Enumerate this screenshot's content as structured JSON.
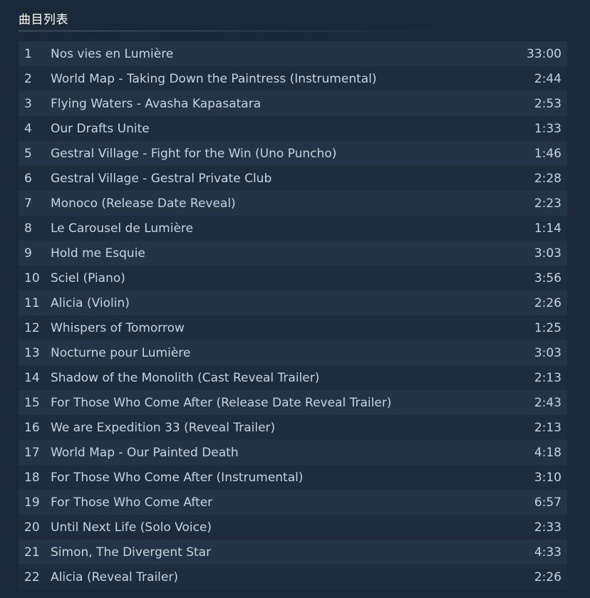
{
  "section": {
    "title": "曲目列表"
  },
  "tracks": [
    {
      "num": "1",
      "name": "Nos vies en Lumière",
      "duration": "33:00"
    },
    {
      "num": "2",
      "name": "World Map - Taking Down the Paintress (Instrumental)",
      "duration": "2:44"
    },
    {
      "num": "3",
      "name": "Flying Waters - Avasha Kapasatara",
      "duration": "2:53"
    },
    {
      "num": "4",
      "name": "Our Drafts Unite",
      "duration": "1:33"
    },
    {
      "num": "5",
      "name": "Gestral Village - Fight for the Win (Uno Puncho)",
      "duration": "1:46"
    },
    {
      "num": "6",
      "name": "Gestral Village - Gestral Private Club",
      "duration": "2:28"
    },
    {
      "num": "7",
      "name": "Monoco (Release Date Reveal)",
      "duration": "2:23"
    },
    {
      "num": "8",
      "name": "Le Carousel de Lumière",
      "duration": "1:14"
    },
    {
      "num": "9",
      "name": "Hold me Esquie",
      "duration": "3:03"
    },
    {
      "num": "10",
      "name": "Sciel (Piano)",
      "duration": "3:56"
    },
    {
      "num": "11",
      "name": "Alicia (Violin)",
      "duration": "2:26"
    },
    {
      "num": "12",
      "name": "Whispers of Tomorrow",
      "duration": "1:25"
    },
    {
      "num": "13",
      "name": "Nocturne pour Lumière",
      "duration": "3:03"
    },
    {
      "num": "14",
      "name": "Shadow of the Monolith (Cast Reveal Trailer)",
      "duration": "2:13"
    },
    {
      "num": "15",
      "name": "For Those Who Come After (Release Date Reveal Trailer)",
      "duration": "2:43"
    },
    {
      "num": "16",
      "name": "We are Expedition 33 (Reveal Trailer)",
      "duration": "2:13"
    },
    {
      "num": "17",
      "name": "World Map - Our Painted Death",
      "duration": "4:18"
    },
    {
      "num": "18",
      "name": "For Those Who Come After (Instrumental)",
      "duration": "3:10"
    },
    {
      "num": "19",
      "name": "For Those Who Come After",
      "duration": "6:57"
    },
    {
      "num": "20",
      "name": "Until Next Life (Solo Voice)",
      "duration": "2:33"
    },
    {
      "num": "21",
      "name": "Simon, The Divergent Star",
      "duration": "4:33"
    },
    {
      "num": "22",
      "name": "Alicia (Reveal Trailer)",
      "duration": "2:26"
    }
  ],
  "colors": {
    "background": "#1b2838",
    "row_odd": "#233447",
    "row_even": "#1e2d3e",
    "text": "#c6d4df",
    "title": "#ffffff",
    "rule": "#3d6c8d"
  }
}
